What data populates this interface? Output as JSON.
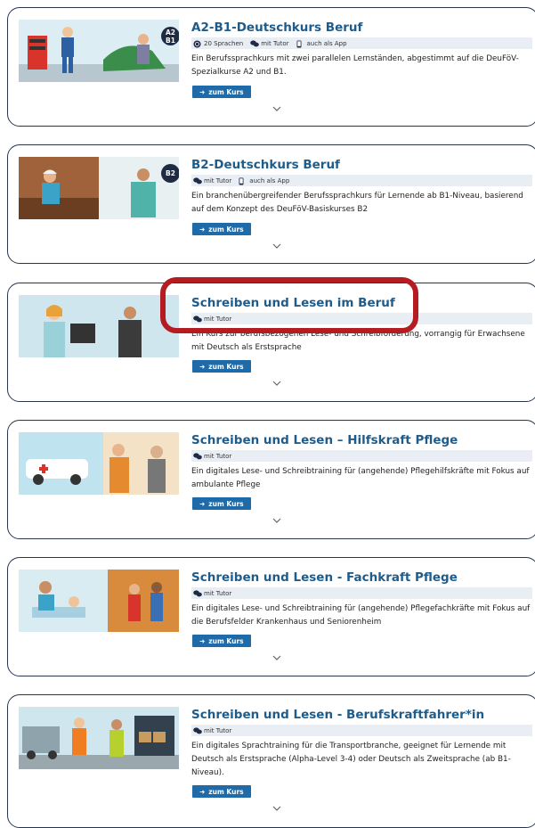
{
  "courses": [
    {
      "title": "A2-B1-Deutschkurs Beruf",
      "badge": "A2\nB1",
      "meta": {
        "languages": "20 Sprachen",
        "tutor": "mit Tutor",
        "app": "auch als App"
      },
      "description": "Ein Berufssprachkurs mit zwei parallelen Lernständen, abgestimmt auf die DeuFöV-Spezialkurse A2 und B1.",
      "button": "zum Kurs"
    },
    {
      "title": "B2-Deutschkurs Beruf",
      "badge": "B2",
      "meta": {
        "tutor": "mit Tutor",
        "app": "auch als App"
      },
      "description": "Ein branchenübergreifender Berufssprachkurs für Lernende ab B1-Niveau, basierend auf dem Konzept des DeuFöV-Basiskurses B2",
      "button": "zum Kurs"
    },
    {
      "title": "Schreiben und Lesen im Beruf",
      "meta": {
        "tutor": "mit Tutor"
      },
      "description": "Ein Kurs zur berufsbezogenen Lese- und Schreibförderung, vorrangig für Erwachsene mit Deutsch als Erstsprache",
      "button": "zum Kurs"
    },
    {
      "title": "Schreiben und Lesen – Hilfskraft Pflege",
      "meta": {
        "tutor": "mit Tutor"
      },
      "description": "Ein digitales Lese- und Schreibtraining für (angehende) Pflegehilfskräfte mit Fokus auf ambulante Pflege",
      "button": "zum Kurs"
    },
    {
      "title": "Schreiben und Lesen - Fachkraft Pflege",
      "meta": {
        "tutor": "mit Tutor"
      },
      "description": "Ein digitales Lese- und Schreibtraining für (angehende) Pflegefachkräfte mit Fokus auf die Berufsfelder Krankenhaus und Seniorenheim",
      "button": "zum Kurs"
    },
    {
      "title": "Schreiben und Lesen - Berufskraftfahrer*in",
      "meta": {
        "tutor": "mit Tutor"
      },
      "description": "Ein digitales Sprachtraining für die Transportbranche, geeignet für Lernende mit Deutsch als Erstsprache (Alpha-Level 3-4) oder Deutsch als Zweitsprache (ab B1-Niveau).",
      "button": "zum Kurs"
    }
  ],
  "colors": {
    "title": "#1e5c8c",
    "button": "#1f6aa9",
    "highlight": "#b51c22",
    "border": "#27364f"
  }
}
